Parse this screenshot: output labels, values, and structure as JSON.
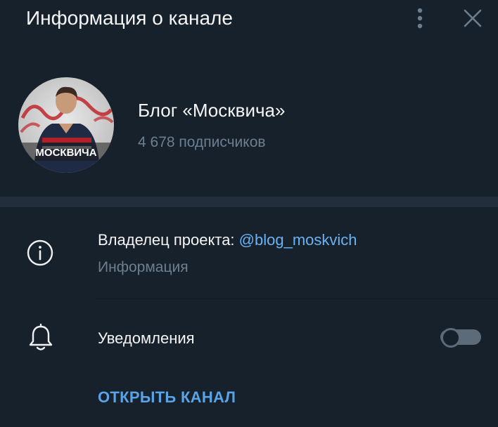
{
  "header": {
    "title": "Информация о канале",
    "more_icon": "more-vertical-icon",
    "close_icon": "close-icon"
  },
  "channel": {
    "name": "Блог «Москвича»",
    "subscribers": "4 678 подписчиков",
    "avatar_text": "МОСКВИЧА"
  },
  "info_row": {
    "icon": "info-icon",
    "owner_prefix": "Владелец проекта: ",
    "owner_link": "@blog_moskvich",
    "subtitle": "Информация"
  },
  "notifications_row": {
    "icon": "bell-icon",
    "label": "Уведомления",
    "enabled": false
  },
  "actions": {
    "open_channel": "ОТКРЫТЬ КАНАЛ"
  },
  "colors": {
    "background": "#17212b",
    "separator": "#232e3c",
    "accent": "#6ab2f2",
    "secondary_text": "#6d7f8f",
    "primary_text": "#f5f5f5"
  }
}
